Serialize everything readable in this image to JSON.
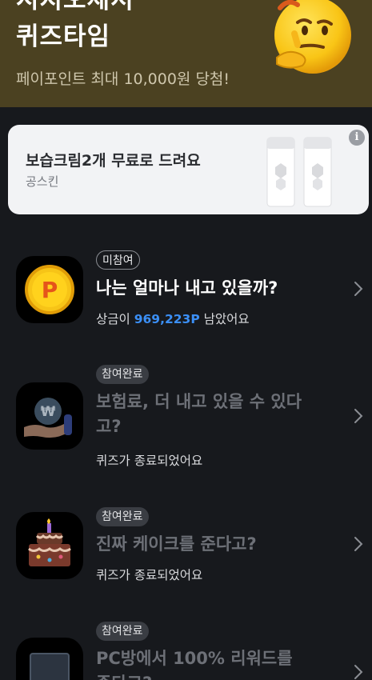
{
  "banner": {
    "title_line1": "시지오세서",
    "title_line2": "퀴즈타임",
    "subtitle": "페이포인트 최대 10,000원 당첨!",
    "mascot_icon": "thinking-face-icon"
  },
  "ad": {
    "title": "보습크림2개 무료로 드려요",
    "brand": "공스킨",
    "info_icon": "info-icon",
    "image": "cream-tubes-image"
  },
  "quizzes": [
    {
      "badge": "미참여",
      "title": "나는 얼마나 내고 있을까?",
      "desc_prefix": "상금이 ",
      "prize": "969,223P",
      "desc_suffix": " 남았어요",
      "icon": "gold-coin-p-icon",
      "status": "open"
    },
    {
      "badge": "참여완료",
      "title": "보험료, 더 내고 있을 수 있다고?",
      "desc": "퀴즈가 종료되었어요",
      "icon": "coin-hand-icon",
      "status": "done"
    },
    {
      "badge": "참여완료",
      "title": "진짜 케이크를 준다고?",
      "desc": "퀴즈가 종료되었어요",
      "icon": "cake-icon",
      "status": "done"
    },
    {
      "badge": "참여완료",
      "title": "PC방에서 100% 리워드를",
      "title_line2": "준다고?",
      "icon": "pc-monitor-icon",
      "status": "done"
    }
  ],
  "colors": {
    "banner_bg": "#4b4121",
    "page_bg": "#17191d",
    "prize_accent": "#3b8ff6",
    "ad_card_bg": "#f2f3f5"
  }
}
